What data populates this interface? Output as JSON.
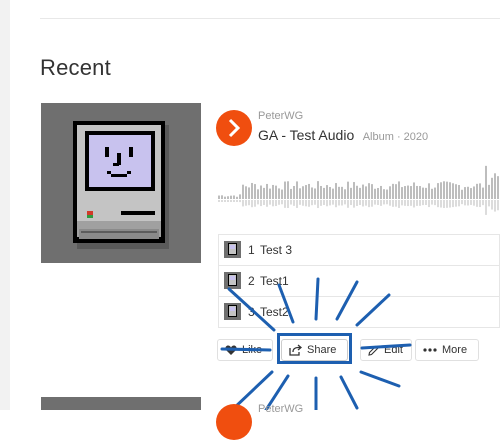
{
  "section": {
    "title": "Recent"
  },
  "release": {
    "artist": "PeterWG",
    "title": "GA - Test Audio",
    "meta": "Album · 2020"
  },
  "tracks": [
    {
      "number": "1",
      "name": "Test 3"
    },
    {
      "number": "2",
      "name": "Test1"
    },
    {
      "number": "3",
      "name": "Test2"
    }
  ],
  "actions": {
    "like": "Like",
    "share": "Share",
    "edit": "Edit",
    "more": "More"
  },
  "next_release": {
    "artist": "PeterWG"
  },
  "colors": {
    "accent": "#f04e0f",
    "highlight": "#1d5fb0"
  }
}
